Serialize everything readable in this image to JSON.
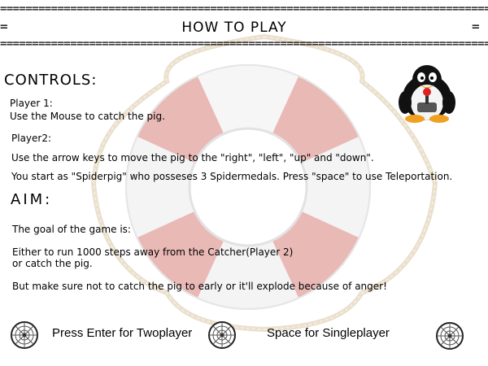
{
  "header": {
    "rule_top": "===============================================================================================================",
    "rule_bottom": "===============================================================================================================",
    "left_mark": "=",
    "right_mark": "=",
    "title": "HOW TO PLAY"
  },
  "controls": {
    "heading": "CONTROLS:",
    "player1_label": "Player 1:",
    "player1_text": "Use the Mouse to catch the pig.",
    "player2_label": "Player2:",
    "player2_text": "Use the arrow keys to move the pig to the \"right\", \"left\", \"up\" and \"down\".",
    "spiderpig_text": "You start as \"Spiderpig\" who posseses 3 Spidermedals. Press \"space\" to use Teleportation."
  },
  "aim": {
    "heading": "AIM:",
    "goal": "The goal of the game is:",
    "either_line1": "Either to run 1000 steps away from the Catcher(Player 2)",
    "either_line2": "or catch the  pig.",
    "warning": "But make sure not to catch the pig to early or it'll explode because of anger!"
  },
  "footer": {
    "twoplayer": "Press Enter for Twoplayer",
    "singleplayer": "Space for Singleplayer"
  },
  "icons": [
    "tux-joystick-icon",
    "spider-web-icon"
  ],
  "colors": {
    "buoy_red": "#e9b9b6",
    "buoy_white": "#f6f6f6",
    "rope": "#eadfcc",
    "text": "#000000"
  }
}
